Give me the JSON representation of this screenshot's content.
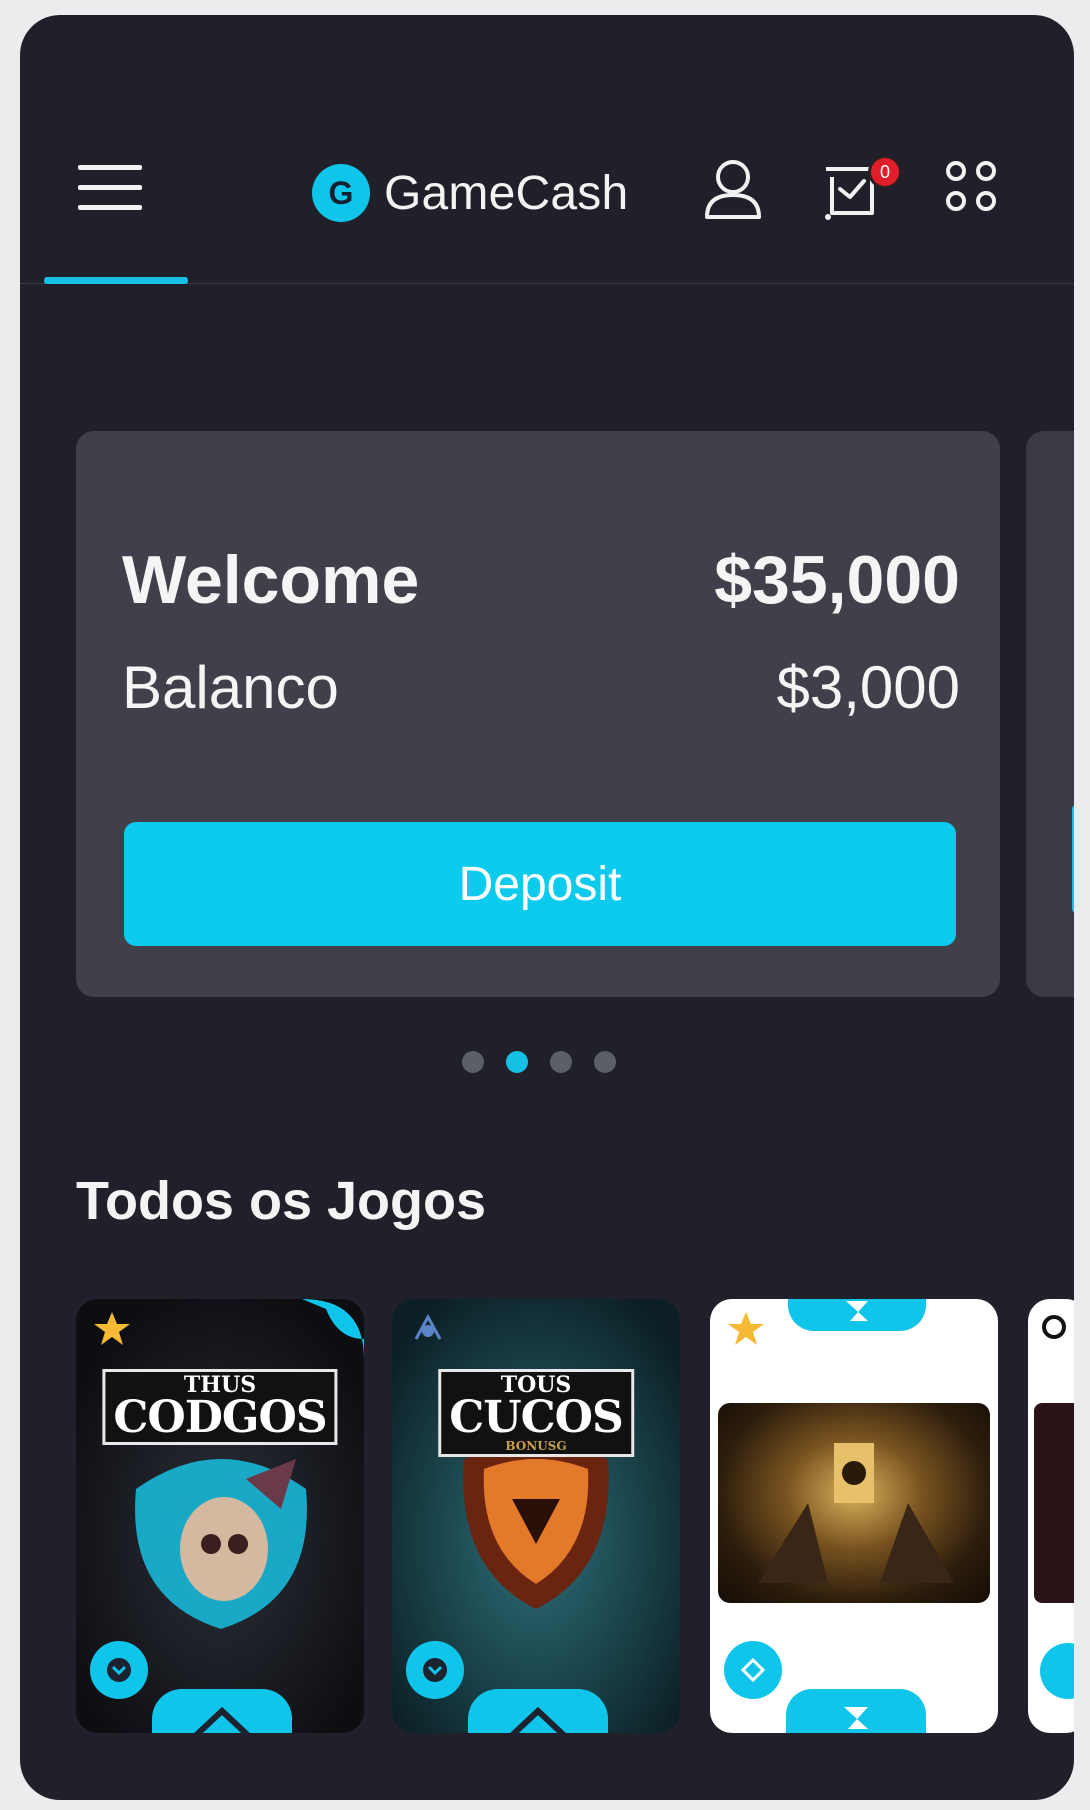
{
  "header": {
    "brand_letter": "G",
    "brand_name": "GameCash",
    "cart_badge": "0",
    "icons": [
      "menu-icon",
      "user-icon",
      "cart-check-icon",
      "apps-grid-icon"
    ]
  },
  "balance_card": {
    "welcome_label": "Welcome",
    "welcome_amount": "$35,000",
    "balance_label": "Balanco",
    "balance_amount": "$3,000",
    "deposit_label": "Deposit"
  },
  "carousel": {
    "count": 4,
    "active_index": 1
  },
  "games_section": {
    "title": "Todos os Jogos",
    "tiles": [
      {
        "logo_top": "THUS",
        "logo_main": "CODGOS",
        "logo_sub": ""
      },
      {
        "logo_top": "TOUS",
        "logo_main": "CUCOS",
        "logo_sub": "BONUSG"
      },
      {
        "logo_top": "",
        "logo_main": "",
        "logo_sub": ""
      }
    ]
  },
  "colors": {
    "accent": "#0ccbed",
    "background": "#1f2029",
    "card": "#3f4049",
    "badge": "#e01e2a",
    "star": "#f5b935"
  }
}
